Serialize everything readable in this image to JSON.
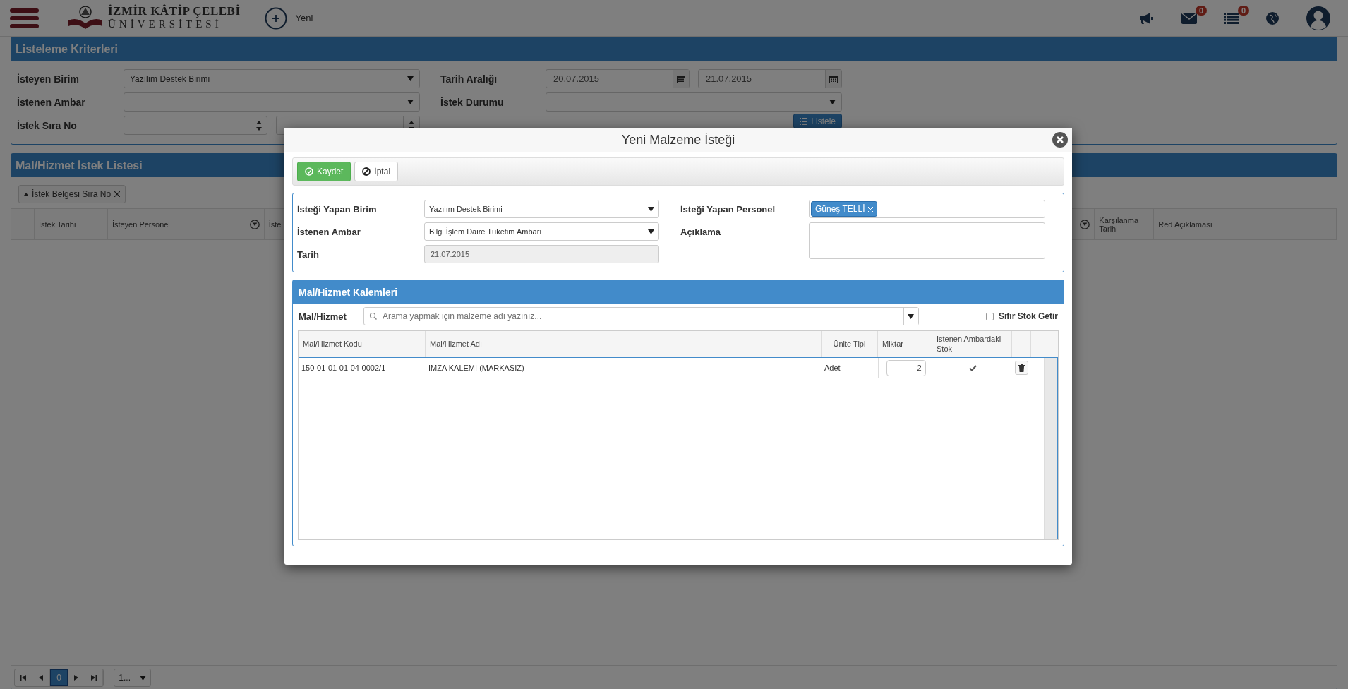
{
  "header": {
    "logo_line1": "İZMİR KÂTİP ÇELEBİ",
    "logo_line2": "ÜNİVERSİTESİ",
    "new_label": "Yeni",
    "icons": [
      {
        "kind": "megaphone"
      },
      {
        "kind": "mail",
        "count": "0"
      },
      {
        "kind": "list",
        "count": "0"
      },
      {
        "kind": "globe"
      },
      {
        "kind": "avatar"
      }
    ]
  },
  "criteria": {
    "title": "Listeleme Kriterleri",
    "requesting_unit": {
      "label": "İsteyen Birim",
      "value": "Yazılım Destek Birimi"
    },
    "requested_warehouse": {
      "label": "İstenen Ambar"
    },
    "request_no": {
      "label": "İstek Sıra No"
    },
    "date_range": {
      "label": "Tarih Aralığı",
      "from": "20.07.2015",
      "to": "21.07.2015"
    },
    "request_status": {
      "label": "İstek Durumu"
    },
    "list_button": "Listele"
  },
  "request_list": {
    "title": "Mal/Hizmet İstek Listesi",
    "sort_chip": "İstek Belgesi Sıra No",
    "columns": [
      {
        "label": "İstek Tarihi",
        "filter": false
      },
      {
        "label": "İsteyen Personel",
        "filter": true
      },
      {
        "label": "İste",
        "filter": false
      },
      {
        "filter": true
      },
      {
        "label": "Karşılanma Tarihi",
        "filter": false
      },
      {
        "label": "Red Açıklaması",
        "filter": false
      }
    ],
    "pager": {
      "current": "0",
      "page_size": "1..."
    }
  },
  "modal": {
    "title": "Yeni Malzeme İsteği",
    "buttons": [
      {
        "kind": "save",
        "label": "Kaydet"
      },
      {
        "kind": "cancel",
        "label": "İptal"
      }
    ],
    "form": {
      "unit": {
        "label": "İsteği Yapan Birim",
        "value": "Yazılım Destek Birimi"
      },
      "warehouse": {
        "label": "İstenen Ambar",
        "value": "Bilgi İşlem Daire Tüketim Ambarı"
      },
      "date": {
        "label": "Tarih",
        "value": "21.07.2015",
        "disabled": true
      },
      "personnel": {
        "label": "İsteği Yapan Personel",
        "tags": [
          "Güneş TELLİ"
        ]
      },
      "description": {
        "label": "Açıklama"
      }
    },
    "items": {
      "title": "Mal/Hizmet Kalemleri",
      "search": {
        "label": "Mal/Hizmet",
        "placeholder": "Arama yapmak için malzeme adı yazınız..."
      },
      "zero_stock": {
        "label": "Sıfır Stok Getir",
        "checked": false
      },
      "columns": [
        "Mal/Hizmet Kodu",
        "Mal/Hizmet Adı",
        "Ünite Tipi",
        "Miktar",
        "İstenen Ambardaki Stok"
      ],
      "rows": [
        {
          "code": "150-01-01-01-04-0002/1",
          "name": "İMZA KALEMİ (MARKASIZ)",
          "unit": "Adet",
          "quantity": "2",
          "in_stock": true
        }
      ]
    }
  }
}
